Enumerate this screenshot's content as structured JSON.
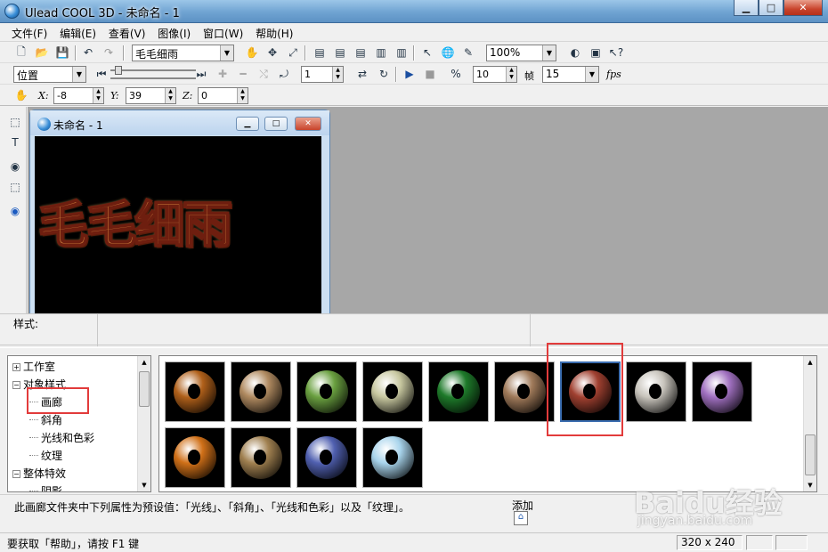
{
  "window": {
    "title": "Ulead COOL 3D - 未命名 - 1"
  },
  "menubar": {
    "items": [
      "文件(F)",
      "编辑(E)",
      "查看(V)",
      "图像(I)",
      "窗口(W)",
      "帮助(H)"
    ]
  },
  "toolbar1": {
    "text_combo": "毛毛细雨",
    "zoom_combo": "100%"
  },
  "toolbar2": {
    "mode_combo": "位置",
    "frame_value": "1",
    "frames_value": "10",
    "frame_label": "帧",
    "fps_value": "15",
    "fps_label": "fps"
  },
  "toolbar3": {
    "x_label": "X:",
    "x_value": "-8",
    "y_label": "Y:",
    "y_value": "39",
    "z_label": "Z:",
    "z_value": "0"
  },
  "document": {
    "title": "未命名 - 1",
    "canvas_text": "毛毛细雨"
  },
  "style_panel": {
    "label": "样式:"
  },
  "tree": {
    "items": [
      {
        "label": "工作室",
        "level": 0,
        "expander": "+"
      },
      {
        "label": "对象样式",
        "level": 0,
        "expander": "−"
      },
      {
        "label": "画廊",
        "level": 1,
        "expander": ""
      },
      {
        "label": "斜角",
        "level": 1,
        "expander": ""
      },
      {
        "label": "光线和色彩",
        "level": 1,
        "expander": ""
      },
      {
        "label": "纹理",
        "level": 1,
        "expander": ""
      },
      {
        "label": "整体特效",
        "level": 0,
        "expander": "−"
      },
      {
        "label": "阴影",
        "level": 1,
        "expander": ""
      }
    ]
  },
  "gallery": {
    "tiles": [
      {
        "name": "wood-amber",
        "color": "#b0601a"
      },
      {
        "name": "woven-tan",
        "color": "#b08a60"
      },
      {
        "name": "rainbow-weave",
        "color": "#6aa040"
      },
      {
        "name": "marble-green-white",
        "color": "#c8c8a0"
      },
      {
        "name": "green-malachite",
        "color": "#1e7a2a"
      },
      {
        "name": "marble-brown",
        "color": "#a07a5a"
      },
      {
        "name": "autumn-leaves",
        "color": "#a04030"
      },
      {
        "name": "white-stone",
        "color": "#c8c4bc"
      },
      {
        "name": "iridescent",
        "color": "#a070c0"
      },
      {
        "name": "orange-glow",
        "color": "#d07018"
      },
      {
        "name": "granite-gold",
        "color": "#a08050"
      },
      {
        "name": "blue-purple",
        "color": "#5060b0"
      },
      {
        "name": "light-blue",
        "color": "#a8d4ec"
      }
    ],
    "selected_index": 6
  },
  "description": {
    "text": "此画廊文件夹中下列属性为预设值：「光线」、「斜角」、「光线和色彩」以及「纹理」。",
    "add_label": "添加"
  },
  "status": {
    "help_text": "要获取「帮助」，请按 F1 键",
    "size_text": "320 x 240"
  },
  "watermark": {
    "logo": "Baidu经验",
    "url": "jingyan.baidu.com"
  },
  "colors": {
    "highlight": "#e23b3b",
    "workspace": "#a7a7a7"
  }
}
